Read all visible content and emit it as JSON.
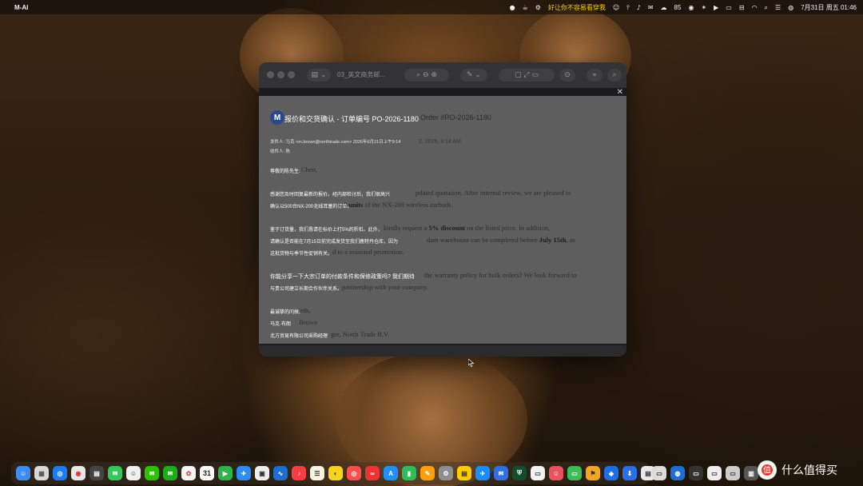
{
  "menubar": {
    "app_name": "M-AI",
    "status_text": "好让你不容易看穿我",
    "battery": "85",
    "datetime": "7月31日 周五 01:46"
  },
  "window": {
    "title": "03_英文商务邮..."
  },
  "email": {
    "avatar_letter": "M",
    "subject_cn": "报价和交货确认 - 订单编号 PO-2026-1180",
    "subject_en": "Order #PO-2026-1180",
    "from_cn": "发件人: 马克 <m.brown@northtrade.com> 2026年6月21日上午9:14",
    "to_cn": "收件人: 陈",
    "date_en": "2, 2026, 9:14 AM",
    "greeting_cn": "尊敬的陈先生:",
    "greeting_en": "Chen,",
    "p1_cn_a": "感谢您及时回复最新的报价。经内部检讨后，我们很高兴",
    "p1_cn_b": "确认以500台NX-200无线耳塞的订单。",
    "p1_en_a": "pdated quotation. After internal review, we are pleased to",
    "p1_en_b_bold": "0 units",
    "p1_en_b": " of the NX-200 wireless earbuds.",
    "p2_cn_a": "鉴于订货量，我们恳请在标价上打5%的折扣。此外，",
    "p2_cn_b": "请确认是否能在7月15日前完成发货至我们鹿特丹仓库，因为",
    "p2_cn_c": "这批货物与季节性促销有关。",
    "p2_en_a": " kindly request a ",
    "p2_en_a_bold": "5% discount",
    "p2_en_a2": " on the listed price. In addition,",
    "p2_en_b": "dam warehouse can be completed before ",
    "p2_en_b_bold": "July 15th",
    "p2_en_b2": ", as",
    "p2_en_c": "d to a seasonal promotion.",
    "p3_cn_a": "你能分享一下大宗订单的付款条件和保修政策吗? 我们期待",
    "p3_cn_b": "与贵公司建立长期合作伙伴关系。",
    "p3_en_a": "the warranty policy for bulk orders? We look forward to",
    "p3_en_b": "partnership with your company.",
    "closing_cn": "最诚挚的问候,",
    "closing_en": "rds,",
    "name_cn": "马克·布朗",
    "name_en": "Brown",
    "title_cn": "北方贸易有限公司采购经理",
    "title_en": "ger, North Trade B.V."
  },
  "dock": {
    "calendar_day": "31"
  },
  "watermark": {
    "text": "什么值得买"
  },
  "colors": {
    "document_gray": "#5e5e5f",
    "avatar_blue": "#2b4a8a",
    "menubar_accent": "#ffd000"
  }
}
